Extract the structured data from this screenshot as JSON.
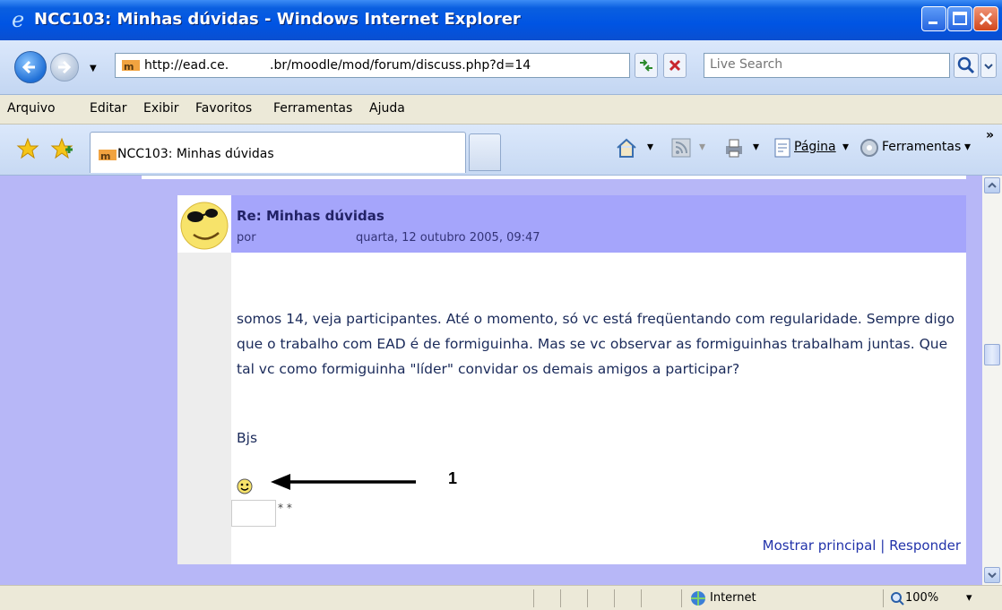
{
  "window": {
    "title": "NCC103: Minhas dúvidas - Windows Internet Explorer"
  },
  "address": {
    "url_part1": "http://ead.ce.",
    "url_part2": ".br/moodle/mod/forum/discuss.php?d=14"
  },
  "search": {
    "placeholder": "Live Search"
  },
  "menu": {
    "items": [
      "Arquivo",
      "Editar",
      "Exibir",
      "Favoritos",
      "Ferramentas",
      "Ajuda"
    ]
  },
  "tab": {
    "label": "NCC103: Minhas dúvidas"
  },
  "commands": {
    "page_label": "Página",
    "tools_label": "Ferramentas"
  },
  "post": {
    "subject": "Re: Minhas dúvidas",
    "by": "por",
    "date": "quarta, 12 outubro 2005, 09:47",
    "body": "somos 14, veja participantes. Até o momento, só vc está freqüentando com regularidade. Sempre digo que o trabalho com EAD é de formiguinha. Mas se vc observar as formiguinhas trabalham juntas. Que tal vc como formiguinha \"líder\" convidar os demais amigos a participar?",
    "signature": "Bjs",
    "stars": "* *",
    "link_parent": "Mostrar principal",
    "link_sep": "|",
    "link_reply": "Responder"
  },
  "annotation": {
    "label": "1"
  },
  "status": {
    "zone": "Internet",
    "zoom": "100%"
  }
}
